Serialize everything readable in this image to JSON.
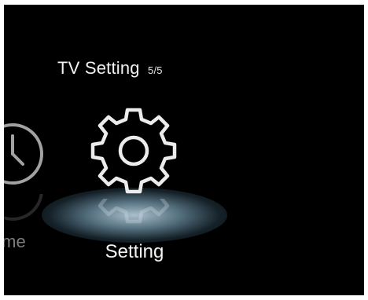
{
  "header": {
    "title": "TV Setting",
    "page_indicator": "5/5"
  },
  "menu": {
    "items": [
      {
        "label": "ime",
        "icon": "clock-icon",
        "selected": false
      },
      {
        "label": "Setting",
        "icon": "gear-icon",
        "selected": true
      }
    ]
  },
  "colors": {
    "background": "#000000",
    "text_primary": "#f5f5f5",
    "text_dimmed": "#7d7d7d",
    "glow": "#c8e1f0"
  }
}
